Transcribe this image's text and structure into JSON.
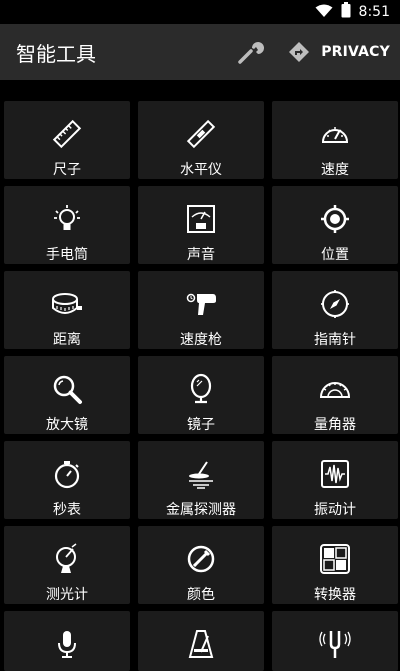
{
  "status_bar": {
    "time": "8:51",
    "icons": [
      "wifi-icon",
      "battery-icon"
    ]
  },
  "app_bar": {
    "title": "智能工具",
    "actions": [
      {
        "name": "wrench-icon"
      },
      {
        "name": "directions-icon"
      }
    ],
    "privacy_label": "PRIVACY"
  },
  "tools": [
    {
      "label": "尺子",
      "icon": "ruler-icon"
    },
    {
      "label": "水平仪",
      "icon": "level-icon"
    },
    {
      "label": "速度",
      "icon": "speedometer-icon"
    },
    {
      "label": "手电筒",
      "icon": "flashlight-bulb-icon"
    },
    {
      "label": "声音",
      "icon": "decibel-meter-icon"
    },
    {
      "label": "位置",
      "icon": "location-target-icon"
    },
    {
      "label": "距离",
      "icon": "measuring-tape-icon"
    },
    {
      "label": "速度枪",
      "icon": "speed-gun-icon"
    },
    {
      "label": "指南针",
      "icon": "compass-icon"
    },
    {
      "label": "放大镜",
      "icon": "magnifier-icon"
    },
    {
      "label": "镜子",
      "icon": "mirror-icon"
    },
    {
      "label": "量角器",
      "icon": "protractor-icon"
    },
    {
      "label": "秒表",
      "icon": "stopwatch-icon"
    },
    {
      "label": "金属探测器",
      "icon": "metal-detector-icon"
    },
    {
      "label": "振动计",
      "icon": "vibration-meter-icon"
    },
    {
      "label": "测光计",
      "icon": "light-meter-icon"
    },
    {
      "label": "颜色",
      "icon": "color-picker-icon"
    },
    {
      "label": "转换器",
      "icon": "unit-converter-icon"
    }
  ],
  "partial_row": [
    {
      "icon": "microphone-icon"
    },
    {
      "icon": "metronome-icon"
    },
    {
      "icon": "tuning-fork-icon"
    }
  ]
}
